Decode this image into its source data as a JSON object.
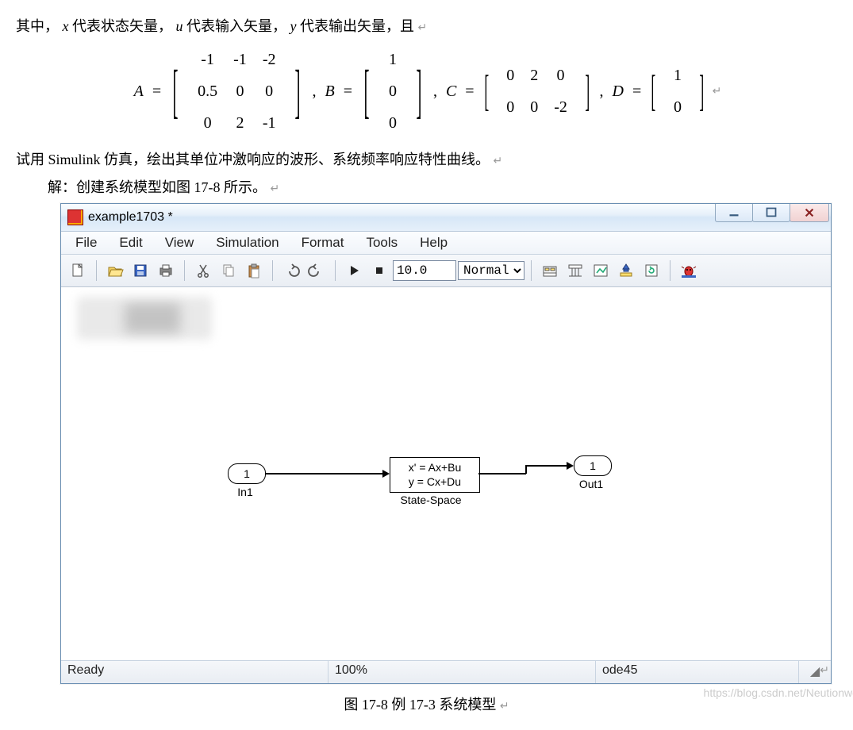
{
  "text": {
    "line1_pre": "其中，",
    "line1_x": "x",
    "line1_xdesc": " 代表状态矢量，",
    "line1_u": "u",
    "line1_udesc": " 代表输入矢量，",
    "line1_y": "y",
    "line1_ydesc": " 代表输出矢量，且",
    "line2": "试用 Simulink 仿真，绘出其单位冲激响应的波形、系统频率响应特性曲线。",
    "line3": "解：创建系统模型如图 17-8 所示。",
    "caption": "图 17-8    例 17-3 系统模型",
    "return": "↵"
  },
  "matrices": {
    "A": [
      [
        "-1",
        "-1",
        "-2"
      ],
      [
        "0.5",
        "0",
        "0"
      ],
      [
        "0",
        "2",
        "-1"
      ]
    ],
    "B": [
      [
        "1"
      ],
      [
        "0"
      ],
      [
        "0"
      ]
    ],
    "C": [
      [
        "0",
        "2",
        "0"
      ],
      [
        "0",
        "0",
        "-2"
      ]
    ],
    "D": [
      [
        "1"
      ],
      [
        "0"
      ]
    ],
    "sep": ",  "
  },
  "window": {
    "title": "example1703 *",
    "menus": [
      "File",
      "Edit",
      "View",
      "Simulation",
      "Format",
      "Tools",
      "Help"
    ],
    "stop_time": "10.0",
    "mode": "Normal",
    "status": {
      "left": "Ready",
      "mid": "100%",
      "right": "ode45"
    },
    "blocks": {
      "in_num": "1",
      "in_label": "In1",
      "ss_line1": "x' = Ax+Bu",
      "ss_line2": "y = Cx+Du",
      "ss_label": "State-Space",
      "out_num": "1",
      "out_label": "Out1"
    }
  },
  "watermark": "https://blog.csdn.net/Neutionwei"
}
